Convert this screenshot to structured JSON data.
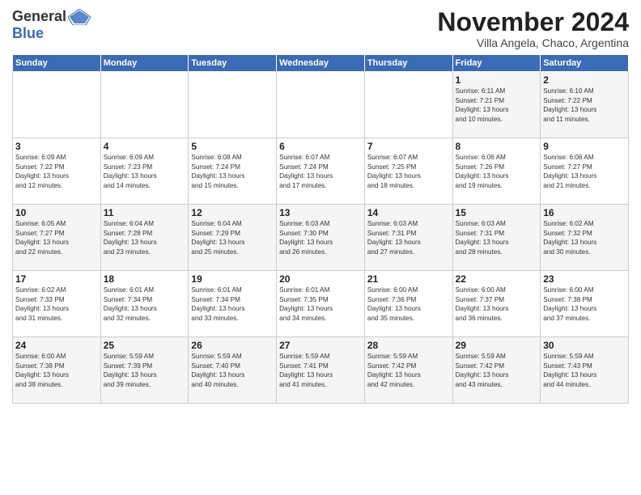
{
  "logo": {
    "general": "General",
    "blue": "Blue"
  },
  "title": "November 2024",
  "subtitle": "Villa Angela, Chaco, Argentina",
  "days_of_week": [
    "Sunday",
    "Monday",
    "Tuesday",
    "Wednesday",
    "Thursday",
    "Friday",
    "Saturday"
  ],
  "weeks": [
    [
      {
        "day": "",
        "info": ""
      },
      {
        "day": "",
        "info": ""
      },
      {
        "day": "",
        "info": ""
      },
      {
        "day": "",
        "info": ""
      },
      {
        "day": "",
        "info": ""
      },
      {
        "day": "1",
        "info": "Sunrise: 6:11 AM\nSunset: 7:21 PM\nDaylight: 13 hours\nand 10 minutes."
      },
      {
        "day": "2",
        "info": "Sunrise: 6:10 AM\nSunset: 7:22 PM\nDaylight: 13 hours\nand 11 minutes."
      }
    ],
    [
      {
        "day": "3",
        "info": "Sunrise: 6:09 AM\nSunset: 7:22 PM\nDaylight: 13 hours\nand 12 minutes."
      },
      {
        "day": "4",
        "info": "Sunrise: 6:09 AM\nSunset: 7:23 PM\nDaylight: 13 hours\nand 14 minutes."
      },
      {
        "day": "5",
        "info": "Sunrise: 6:08 AM\nSunset: 7:24 PM\nDaylight: 13 hours\nand 15 minutes."
      },
      {
        "day": "6",
        "info": "Sunrise: 6:07 AM\nSunset: 7:24 PM\nDaylight: 13 hours\nand 17 minutes."
      },
      {
        "day": "7",
        "info": "Sunrise: 6:07 AM\nSunset: 7:25 PM\nDaylight: 13 hours\nand 18 minutes."
      },
      {
        "day": "8",
        "info": "Sunrise: 6:06 AM\nSunset: 7:26 PM\nDaylight: 13 hours\nand 19 minutes."
      },
      {
        "day": "9",
        "info": "Sunrise: 6:06 AM\nSunset: 7:27 PM\nDaylight: 13 hours\nand 21 minutes."
      }
    ],
    [
      {
        "day": "10",
        "info": "Sunrise: 6:05 AM\nSunset: 7:27 PM\nDaylight: 13 hours\nand 22 minutes."
      },
      {
        "day": "11",
        "info": "Sunrise: 6:04 AM\nSunset: 7:28 PM\nDaylight: 13 hours\nand 23 minutes."
      },
      {
        "day": "12",
        "info": "Sunrise: 6:04 AM\nSunset: 7:29 PM\nDaylight: 13 hours\nand 25 minutes."
      },
      {
        "day": "13",
        "info": "Sunrise: 6:03 AM\nSunset: 7:30 PM\nDaylight: 13 hours\nand 26 minutes."
      },
      {
        "day": "14",
        "info": "Sunrise: 6:03 AM\nSunset: 7:31 PM\nDaylight: 13 hours\nand 27 minutes."
      },
      {
        "day": "15",
        "info": "Sunrise: 6:03 AM\nSunset: 7:31 PM\nDaylight: 13 hours\nand 28 minutes."
      },
      {
        "day": "16",
        "info": "Sunrise: 6:02 AM\nSunset: 7:32 PM\nDaylight: 13 hours\nand 30 minutes."
      }
    ],
    [
      {
        "day": "17",
        "info": "Sunrise: 6:02 AM\nSunset: 7:33 PM\nDaylight: 13 hours\nand 31 minutes."
      },
      {
        "day": "18",
        "info": "Sunrise: 6:01 AM\nSunset: 7:34 PM\nDaylight: 13 hours\nand 32 minutes."
      },
      {
        "day": "19",
        "info": "Sunrise: 6:01 AM\nSunset: 7:34 PM\nDaylight: 13 hours\nand 33 minutes."
      },
      {
        "day": "20",
        "info": "Sunrise: 6:01 AM\nSunset: 7:35 PM\nDaylight: 13 hours\nand 34 minutes."
      },
      {
        "day": "21",
        "info": "Sunrise: 6:00 AM\nSunset: 7:36 PM\nDaylight: 13 hours\nand 35 minutes."
      },
      {
        "day": "22",
        "info": "Sunrise: 6:00 AM\nSunset: 7:37 PM\nDaylight: 13 hours\nand 36 minutes."
      },
      {
        "day": "23",
        "info": "Sunrise: 6:00 AM\nSunset: 7:38 PM\nDaylight: 13 hours\nand 37 minutes."
      }
    ],
    [
      {
        "day": "24",
        "info": "Sunrise: 6:00 AM\nSunset: 7:38 PM\nDaylight: 13 hours\nand 38 minutes."
      },
      {
        "day": "25",
        "info": "Sunrise: 5:59 AM\nSunset: 7:39 PM\nDaylight: 13 hours\nand 39 minutes."
      },
      {
        "day": "26",
        "info": "Sunrise: 5:59 AM\nSunset: 7:40 PM\nDaylight: 13 hours\nand 40 minutes."
      },
      {
        "day": "27",
        "info": "Sunrise: 5:59 AM\nSunset: 7:41 PM\nDaylight: 13 hours\nand 41 minutes."
      },
      {
        "day": "28",
        "info": "Sunrise: 5:59 AM\nSunset: 7:42 PM\nDaylight: 13 hours\nand 42 minutes."
      },
      {
        "day": "29",
        "info": "Sunrise: 5:59 AM\nSunset: 7:42 PM\nDaylight: 13 hours\nand 43 minutes."
      },
      {
        "day": "30",
        "info": "Sunrise: 5:59 AM\nSunset: 7:43 PM\nDaylight: 13 hours\nand 44 minutes."
      }
    ]
  ]
}
